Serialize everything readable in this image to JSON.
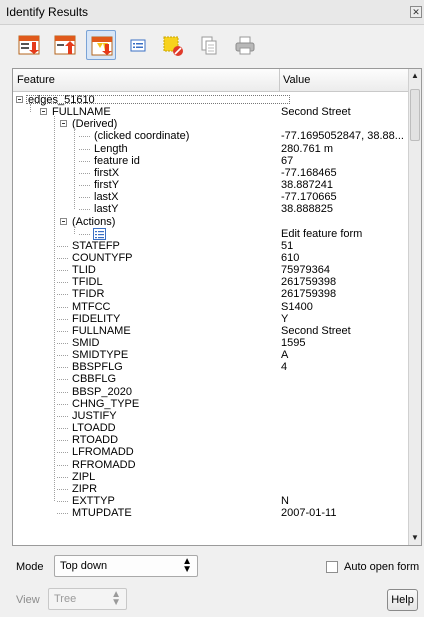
{
  "window": {
    "title": "Identify Results"
  },
  "toolbar": {
    "buttons": [
      {
        "name": "expand-tree-button",
        "icon": "expand-tree-icon",
        "active": false
      },
      {
        "name": "collapse-tree-button",
        "icon": "collapse-tree-icon",
        "active": false
      },
      {
        "name": "expand-new-results-button",
        "icon": "expand-new-icon",
        "active": true
      },
      {
        "name": "open-form-button",
        "icon": "form-icon",
        "active": false
      },
      {
        "name": "clear-results-button",
        "icon": "clear-highlight-icon",
        "active": false
      },
      {
        "name": "copy-feature-button",
        "icon": "copy-icon",
        "active": false
      },
      {
        "name": "print-button",
        "icon": "print-icon",
        "active": false
      }
    ]
  },
  "tree": {
    "headers": {
      "feature": "Feature",
      "value": "Value"
    },
    "rows": [
      {
        "label": "edges_51610",
        "value": "",
        "level": 0,
        "expander": true
      },
      {
        "label": "FULLNAME",
        "value": "Second Street",
        "level": 1,
        "expander": true
      },
      {
        "label": "(Derived)",
        "value": "",
        "level": 2,
        "expander": true
      },
      {
        "label": "(clicked coordinate)",
        "value": "-77.1695052847, 38.88...",
        "level": 3
      },
      {
        "label": "Length",
        "value": "280.761 m",
        "level": 3
      },
      {
        "label": "feature id",
        "value": "67",
        "level": 3
      },
      {
        "label": "firstX",
        "value": "-77.168465",
        "level": 3
      },
      {
        "label": "firstY",
        "value": "38.887241",
        "level": 3
      },
      {
        "label": "lastX",
        "value": "-77.170665",
        "level": 3
      },
      {
        "label": "lastY",
        "value": "38.888825",
        "level": 3
      },
      {
        "label": "(Actions)",
        "value": "",
        "level": 2,
        "expander": true
      },
      {
        "label": "",
        "value": "Edit feature form",
        "level": 3,
        "icon": "form-icon"
      },
      {
        "label": "STATEFP",
        "value": "51",
        "level": 2
      },
      {
        "label": "COUNTYFP",
        "value": "610",
        "level": 2
      },
      {
        "label": "TLID",
        "value": "75979364",
        "level": 2
      },
      {
        "label": "TFIDL",
        "value": "261759398",
        "level": 2
      },
      {
        "label": "TFIDR",
        "value": "261759398",
        "level": 2
      },
      {
        "label": "MTFCC",
        "value": "S1400",
        "level": 2
      },
      {
        "label": "FIDELITY",
        "value": "Y",
        "level": 2
      },
      {
        "label": "FULLNAME",
        "value": "Second Street",
        "level": 2
      },
      {
        "label": "SMID",
        "value": "1595",
        "level": 2
      },
      {
        "label": "SMIDTYPE",
        "value": "A",
        "level": 2
      },
      {
        "label": "BBSPFLG",
        "value": "4",
        "level": 2
      },
      {
        "label": "CBBFLG",
        "value": "",
        "level": 2
      },
      {
        "label": "BBSP_2020",
        "value": "",
        "level": 2
      },
      {
        "label": "CHNG_TYPE",
        "value": "",
        "level": 2
      },
      {
        "label": "JUSTIFY",
        "value": "",
        "level": 2
      },
      {
        "label": "LTOADD",
        "value": "",
        "level": 2
      },
      {
        "label": "RTOADD",
        "value": "",
        "level": 2
      },
      {
        "label": "LFROMADD",
        "value": "",
        "level": 2
      },
      {
        "label": "RFROMADD",
        "value": "",
        "level": 2
      },
      {
        "label": "ZIPL",
        "value": "",
        "level": 2
      },
      {
        "label": "ZIPR",
        "value": "",
        "level": 2
      },
      {
        "label": "EXTTYP",
        "value": "N",
        "level": 2
      },
      {
        "label": "MTUPDATE",
        "value": "2007-01-11",
        "level": 2
      }
    ]
  },
  "footer": {
    "mode_label": "Mode",
    "mode_value": "Top down",
    "auto_open_label": "Auto open form",
    "auto_open_checked": false,
    "view_label": "View",
    "view_value": "Tree",
    "help_label": "Help"
  }
}
